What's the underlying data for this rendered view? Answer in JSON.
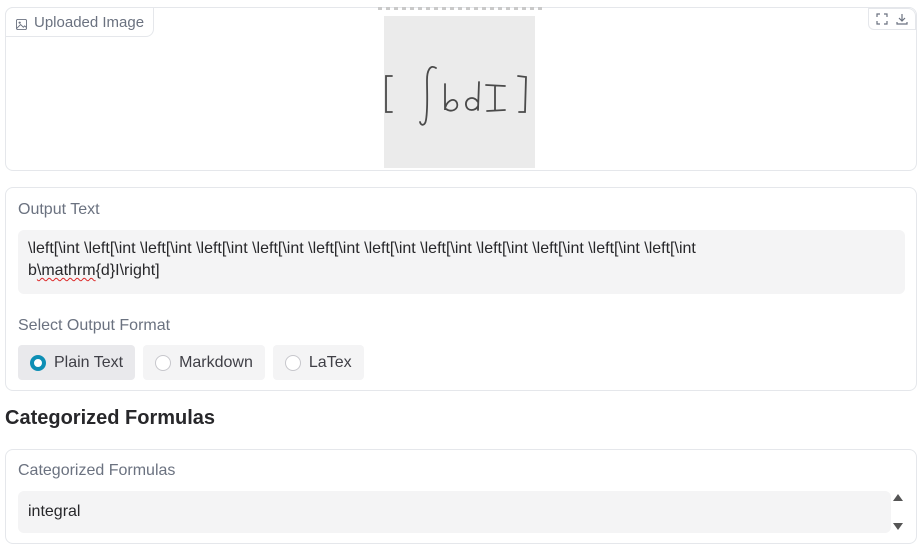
{
  "image_panel": {
    "label": "Uploaded Image",
    "icons": [
      "image-icon",
      "fullscreen-icon",
      "download-icon"
    ]
  },
  "output_panel": {
    "title": "Output Text",
    "text_main": "\\left[\\int \\left[\\int \\left[\\int \\left[\\int \\left[\\int \\left[\\int \\left[\\int \\left[\\int \\left[\\int \\left[\\int \\left[\\int \\left[\\int",
    "text_line2_prefix": "b",
    "text_misspelled": "\\mathrm",
    "text_line2_suffix": "{d}I\\right]",
    "format_label": "Select Output Format",
    "options": [
      "Plain Text",
      "Markdown",
      "LaTex"
    ],
    "selected_option": "Plain Text",
    "accent_color": "#0e8fb5"
  },
  "section_heading": "Categorized Formulas",
  "categorized_panel": {
    "title": "Categorized Formulas",
    "value": "integral"
  }
}
